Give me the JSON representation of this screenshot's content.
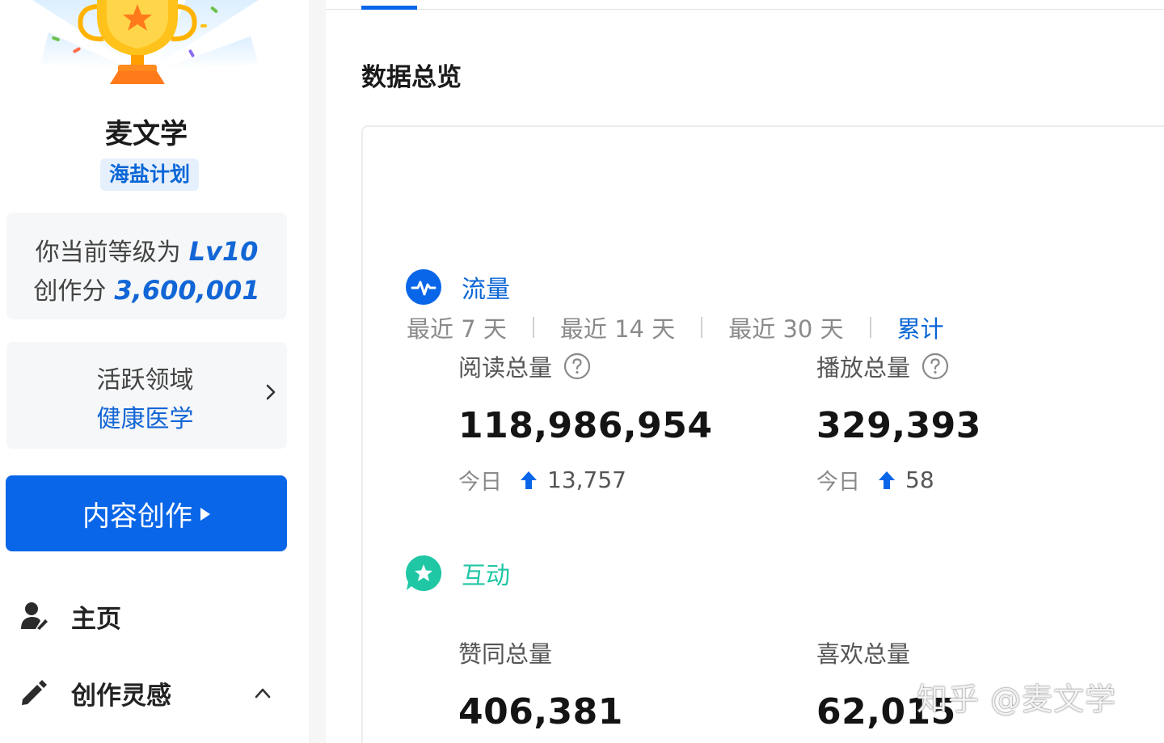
{
  "profile": {
    "username": "麦文学",
    "plan": "海盐计划"
  },
  "level_card": {
    "level_prefix": "你当前等级为",
    "level_value": "Lv10",
    "score_prefix": "创作分",
    "score_value": "3,600,001"
  },
  "field_card": {
    "label": "活跃领域",
    "value": "健康医学"
  },
  "create_button": {
    "label": "内容创作"
  },
  "nav": {
    "home": {
      "label": "主页",
      "icon": "user-edit-icon"
    },
    "inspiration": {
      "label": "创作灵感",
      "icon": "pencil-icon"
    }
  },
  "main": {
    "title": "数据总览",
    "periods": [
      "最近 7 天",
      "最近 14 天",
      "最近 30 天",
      "累计"
    ],
    "active_period": "累计",
    "traffic": {
      "label": "流量",
      "color": "#0a66e8",
      "reads": {
        "label": "阅读总量",
        "value": "118,986,954",
        "today_label": "今日",
        "today_delta": "13,757"
      },
      "plays": {
        "label": "播放总量",
        "value": "329,393",
        "today_label": "今日",
        "today_delta": "58"
      }
    },
    "interaction": {
      "label": "互动",
      "color": "#1fc7a5",
      "upvotes": {
        "label": "赞同总量",
        "value": "406,381"
      },
      "likes": {
        "label": "喜欢总量",
        "value": "62,015"
      }
    }
  },
  "watermark": "知乎 @麦文学",
  "colors": {
    "accent": "#0a66e8",
    "link": "#1266d6",
    "interaction": "#1fc7a5"
  }
}
